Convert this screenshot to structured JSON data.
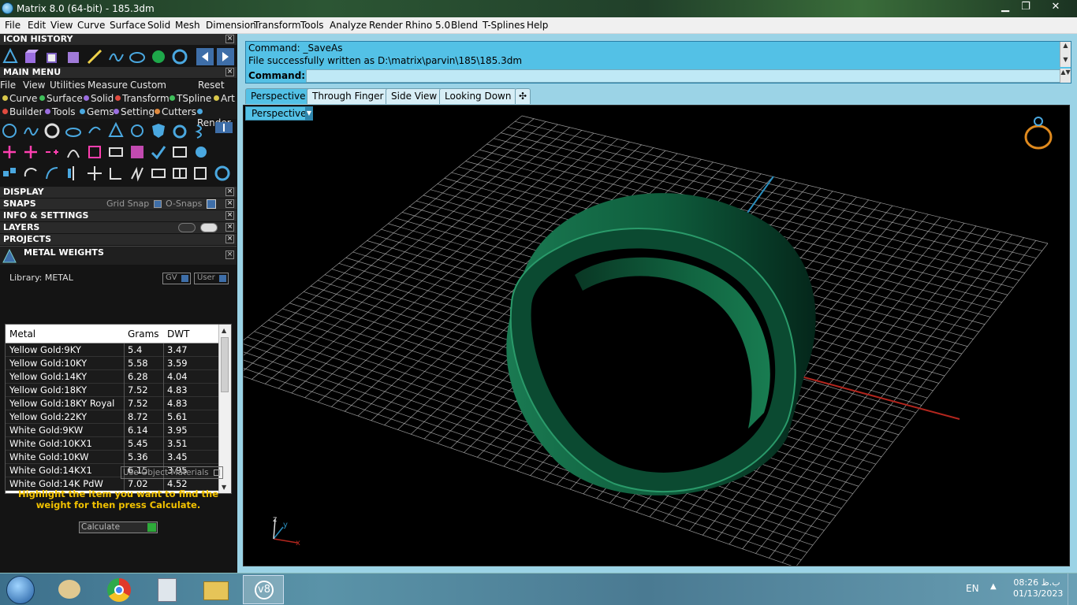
{
  "window": {
    "title": "Matrix 8.0 (64-bit) - 185.3dm",
    "min": "▁",
    "max": "❐",
    "close": "✕"
  },
  "menubar": [
    "File",
    "Edit",
    "View",
    "Curve",
    "Surface",
    "Solid",
    "Mesh",
    "Dimension",
    "Transform",
    "Tools",
    "Analyze",
    "Render",
    "Rhino 5.0",
    "Blend",
    "T-Splines",
    "Help"
  ],
  "left": {
    "icon_history": "ICON HISTORY",
    "main_menu": "MAIN MENU",
    "main_menu_items": [
      "File",
      "View",
      "Utilities",
      "Measure",
      "Custom"
    ],
    "reset": "Reset",
    "row1": [
      "Curve",
      "Surface",
      "Solid",
      "Transform",
      "TSpline",
      "Art"
    ],
    "row2": [
      "Builder",
      "Tools",
      "Gems",
      "Setting",
      "Cutters",
      "Render"
    ],
    "display": "DISPLAY",
    "snaps": "SNAPS",
    "grid_snap": "Grid Snap",
    "osnaps": "O-Snaps",
    "info": "INFO & SETTINGS",
    "layers": "LAYERS",
    "projects": "PROJECTS",
    "metal_weights": "METAL WEIGHTS",
    "library": "Library: METAL",
    "gv": "GV",
    "user": "User",
    "columns": [
      "Metal",
      "Grams",
      "DWT"
    ],
    "rows": [
      [
        "Yellow Gold:9KY",
        "5.4",
        "3.47"
      ],
      [
        "Yellow Gold:10KY",
        "5.58",
        "3.59"
      ],
      [
        "Yellow Gold:14KY",
        "6.28",
        "4.04"
      ],
      [
        "Yellow Gold:18KY",
        "7.52",
        "4.83"
      ],
      [
        "Yellow Gold:18KY Royal",
        "7.52",
        "4.83"
      ],
      [
        "Yellow Gold:22KY",
        "8.72",
        "5.61"
      ],
      [
        "White Gold:9KW",
        "6.14",
        "3.95"
      ],
      [
        "White Gold:10KX1",
        "5.45",
        "3.51"
      ],
      [
        "White Gold:10KW",
        "5.36",
        "3.45"
      ],
      [
        "White Gold:14KX1",
        "6.15",
        "3.95"
      ],
      [
        "White Gold:14K PdW",
        "7.02",
        "4.52"
      ]
    ],
    "use_object_materials": "Use Object Materials",
    "hint": "Highlight the item you want to find the weight for then press Calculate.",
    "calculate": "Calculate"
  },
  "command": {
    "line1": "Command: _SaveAs",
    "line2": "File successfully written as D:\\matrix\\parvin\\185\\185.3dm",
    "prompt": "Command:"
  },
  "tabs": [
    "Perspective",
    "Through Finger",
    "Side View",
    "Looking Down"
  ],
  "add_tab": "✣",
  "viewport": {
    "label": "Perspective",
    "axis_x": "x",
    "axis_y": "y",
    "axis_z": "z"
  },
  "taskbar": {
    "lang": "EN",
    "time": "08:26 ب.ظ",
    "date": "01/13/2023"
  },
  "colors": {
    "ring": "#0f5e3d",
    "grid": "#c8c8c8",
    "cmd_bg": "#53c1e6",
    "hint": "#f2c200"
  }
}
